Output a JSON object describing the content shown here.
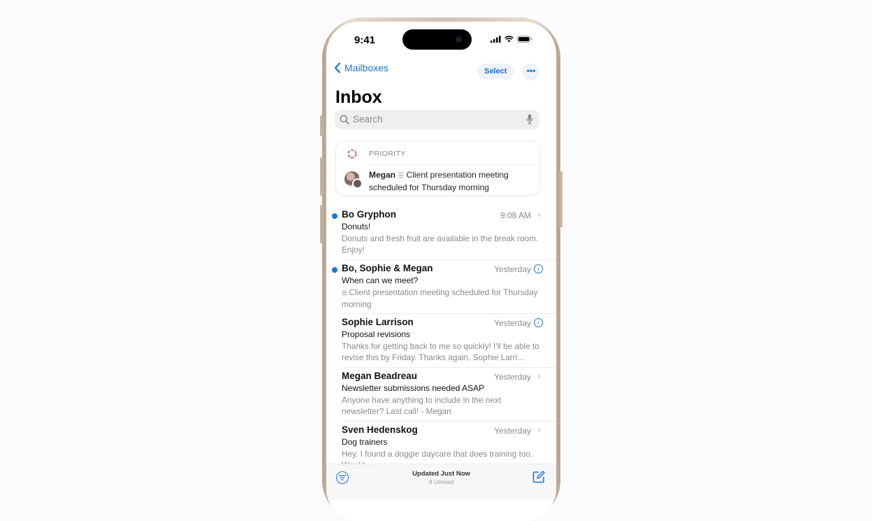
{
  "status_bar": {
    "time": "9:41"
  },
  "nav": {
    "back_label": "Mailboxes",
    "select_label": "Select",
    "more_label": "•••"
  },
  "title": "Inbox",
  "search": {
    "placeholder": "Search"
  },
  "priority": {
    "header": "PRIORITY",
    "sender": "Megan",
    "summary": "Client presentation meeting scheduled for Thursday morning"
  },
  "emails": [
    {
      "sender": "Bo Gryphon",
      "date": "9:08 AM",
      "subject": "Donuts!",
      "preview": "Donuts and fresh fruit are available in the break room. Enjoy!",
      "unread": true,
      "indicator": "chevron"
    },
    {
      "sender": "Bo, Sophie & Megan",
      "date": "Yesterday",
      "subject": "When can we meet?",
      "preview": "Client presentation meeting scheduled for Thursday morning",
      "unread": true,
      "indicator": "thread"
    },
    {
      "sender": "Sophie Larrison",
      "date": "Yesterday",
      "subject": "Proposal revisions",
      "preview": "Thanks for getting back to me so quickly! I'll be able to revise this by Friday. Thanks again, Sophie Larri...",
      "unread": false,
      "indicator": "thread"
    },
    {
      "sender": "Megan Beadreau",
      "date": "Yesterday",
      "subject": "Newsletter submissions needed ASAP",
      "preview": "Anyone have anything to include in the next newsletter? Last call! - Megan",
      "unread": false,
      "indicator": "chevron"
    },
    {
      "sender": "Sven Hedenskog",
      "date": "Yesterday",
      "subject": "Dog trainers",
      "preview": "Hey. I found a doggie daycare that does training too. Would ...",
      "unread": false,
      "indicator": "chevron"
    }
  ],
  "toolbar": {
    "updated": "Updated Just Now",
    "unread_count": "8 Unread"
  },
  "colors": {
    "accent": "#1a73d9",
    "secondary_text": "#8a8a8e"
  }
}
